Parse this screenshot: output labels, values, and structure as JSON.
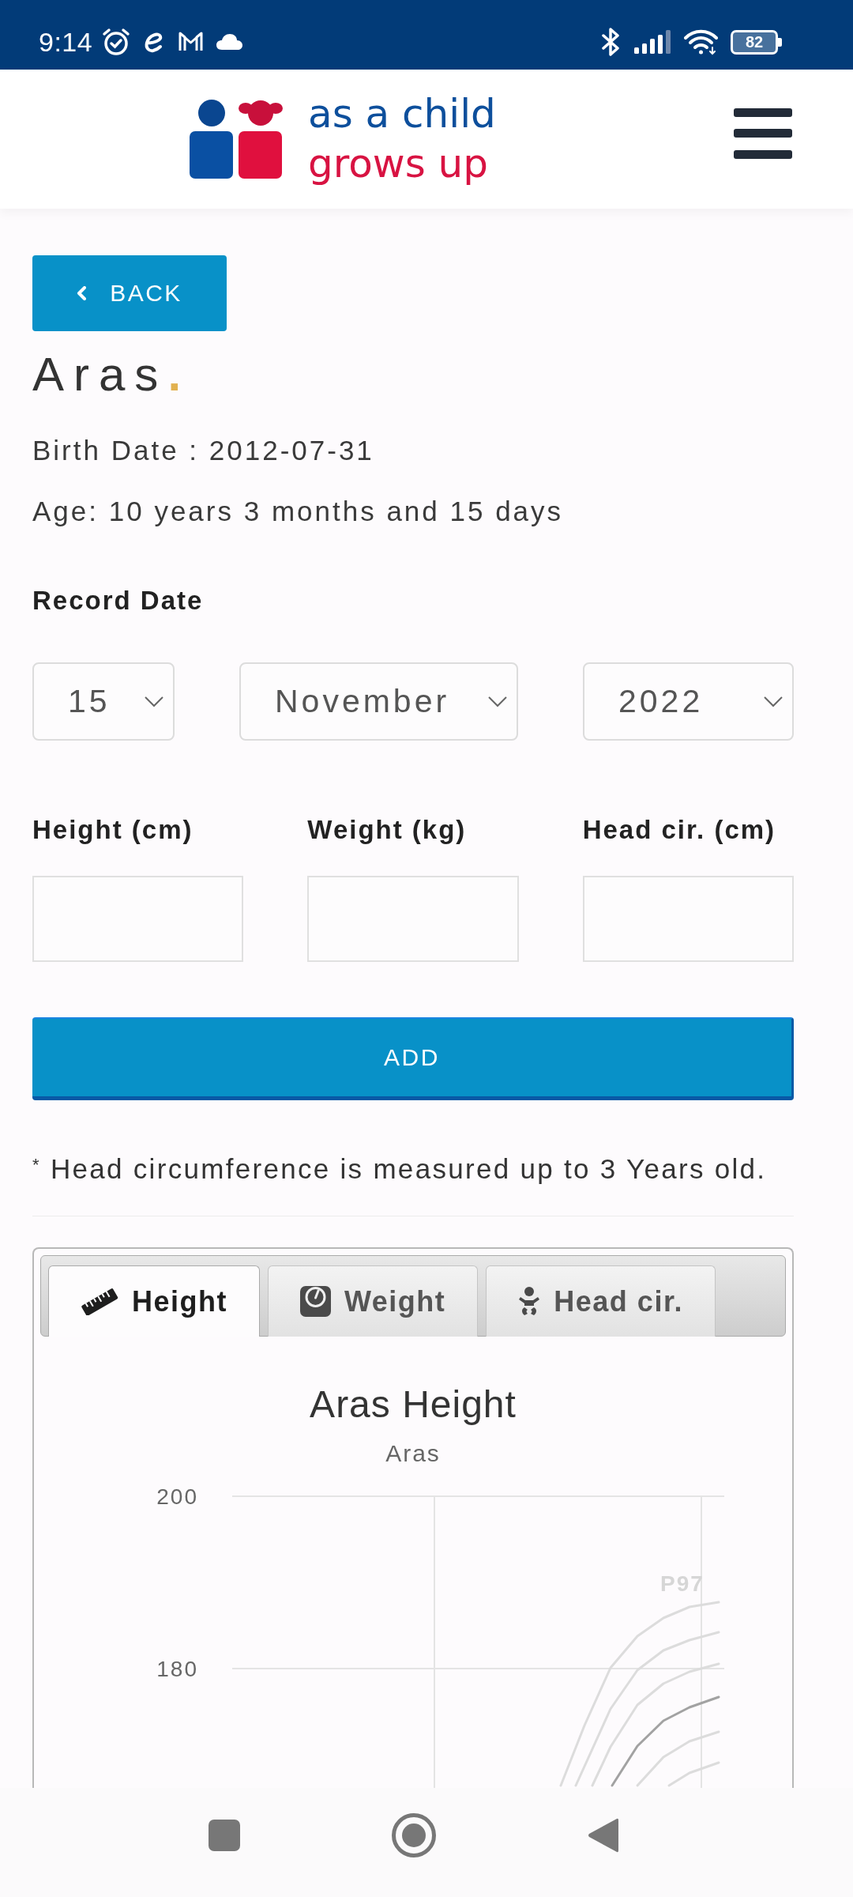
{
  "status_bar": {
    "time": "9:14",
    "battery": "82"
  },
  "header": {
    "logo_line_1": "as a child",
    "logo_line_2": "grows up"
  },
  "back_button": "BACK",
  "child": {
    "name": "Aras",
    "name_accent": ".",
    "birth_date": "Birth Date : 2012-07-31",
    "age": "Age: 10 years 3 months and 15 days"
  },
  "record_date": {
    "label": "Record Date",
    "day": "15",
    "month": "November",
    "year": "2022"
  },
  "measurements": [
    {
      "label": "Height (cm)"
    },
    {
      "label": "Weight (kg)"
    },
    {
      "label": "Head cir. (cm)"
    }
  ],
  "add_button": "ADD",
  "note": "$^{*}$ Head circumference is measured up to 3 Years old.",
  "chart_panel": {
    "tabs": [
      {
        "label": "Height",
        "selected": true
      },
      {
        "label": "Weight",
        "selected": false
      },
      {
        "label": "Head cir.",
        "selected": false
      }
    ],
    "title": "Aras Height",
    "subtitle": "Aras",
    "y_ticks": [
      "200",
      "180"
    ],
    "curve_label": "P97"
  }
}
